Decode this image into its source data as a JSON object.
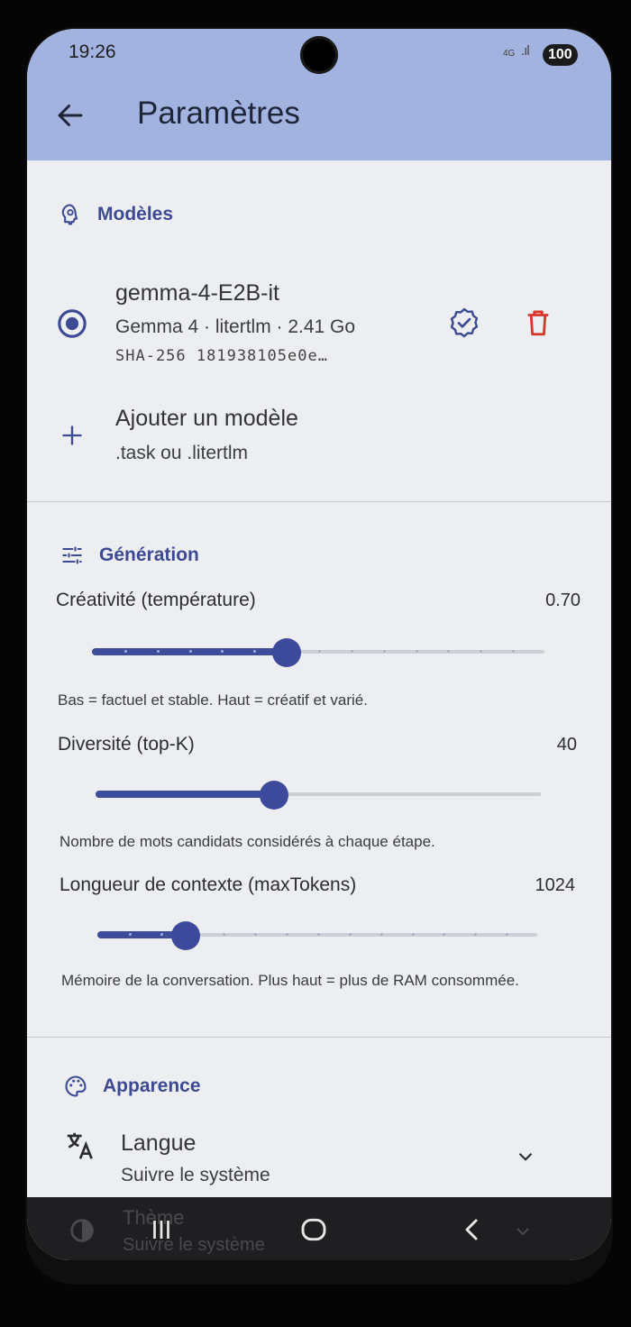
{
  "status": {
    "time": "19:26",
    "network": "4G",
    "battery": "100"
  },
  "appbar": {
    "title": "Paramètres"
  },
  "models": {
    "header": "Modèles",
    "item": {
      "name": "gemma-4-E2B-it",
      "details": "Gemma 4 · litertlm · 2.41 Go",
      "hash": "SHA-256  181938105e0e…"
    },
    "add": {
      "title": "Ajouter un modèle",
      "subtitle": ".task ou .litertlm"
    }
  },
  "generation": {
    "header": "Génération",
    "temperature": {
      "label": "Créativité (température)",
      "value": "0.70",
      "fraction": 0.43,
      "help": "Bas = factuel et stable. Haut = créatif et varié."
    },
    "topk": {
      "label": "Diversité (top-K)",
      "value": "40",
      "fraction": 0.4,
      "help": "Nombre de mots candidats considérés à chaque étape."
    },
    "maxtokens": {
      "label": "Longueur de contexte (maxTokens)",
      "value": "1024",
      "fraction": 0.2,
      "help": "Mémoire de la conversation. Plus haut = plus de RAM consommée."
    }
  },
  "appearance": {
    "header": "Apparence",
    "language": {
      "title": "Langue",
      "value": "Suivre le système"
    },
    "theme": {
      "title": "Thème",
      "value": "Suivre le système"
    }
  },
  "colors": {
    "accent": "#3d4a9b",
    "appbar": "#a3b3e0",
    "delete": "#d9362b"
  }
}
